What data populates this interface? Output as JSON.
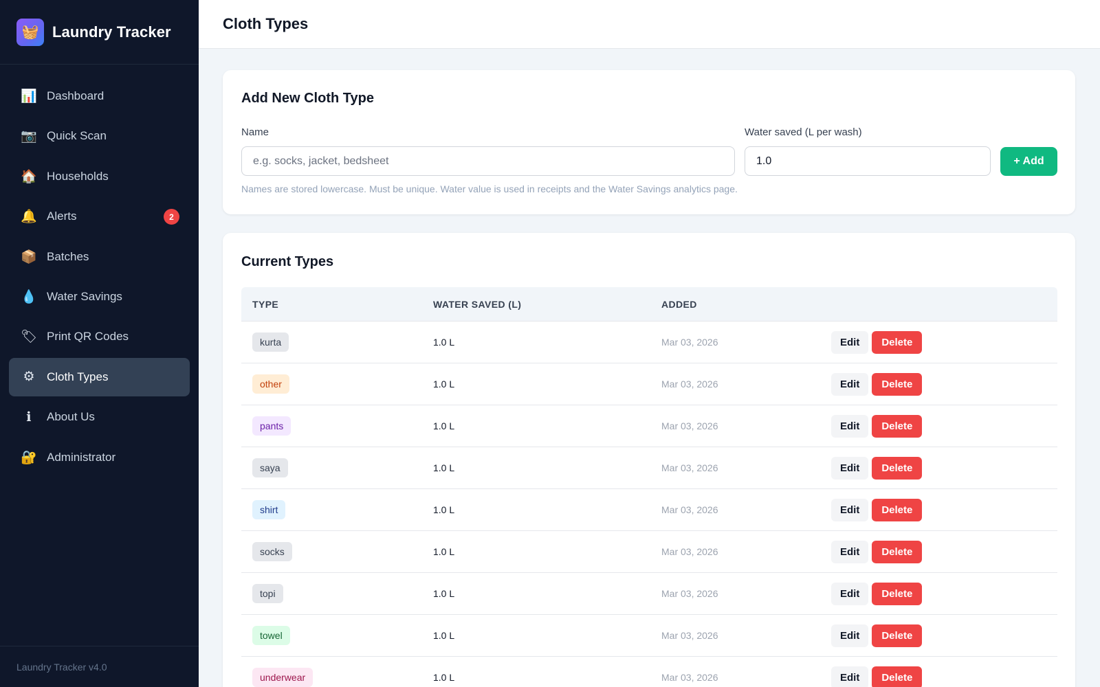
{
  "app": {
    "title": "Laundry Tracker",
    "logo_icon": "basket-icon",
    "version": "Laundry Tracker v4.0"
  },
  "sidebar": {
    "items": [
      {
        "label": "Dashboard",
        "icon": "📊",
        "icon_name": "bar-chart-icon",
        "active": false
      },
      {
        "label": "Quick Scan",
        "icon": "📷",
        "icon_name": "camera-icon",
        "active": false
      },
      {
        "label": "Households",
        "icon": "🏠",
        "icon_name": "house-icon",
        "active": false
      },
      {
        "label": "Alerts",
        "icon": "🔔",
        "icon_name": "bell-icon",
        "active": false,
        "badge": "2"
      },
      {
        "label": "Batches",
        "icon": "📦",
        "icon_name": "package-icon",
        "active": false
      },
      {
        "label": "Water Savings",
        "icon": "💧",
        "icon_name": "water-drop-icon",
        "active": false
      },
      {
        "label": "Print QR Codes",
        "icon": "🏷",
        "icon_name": "label-tag-icon",
        "active": false
      },
      {
        "label": "Cloth Types",
        "icon": "⚙",
        "icon_name": "gear-icon",
        "active": true
      },
      {
        "label": "About Us",
        "icon": "ℹ",
        "icon_name": "info-icon",
        "active": false
      },
      {
        "label": "Administrator",
        "icon": "🔐",
        "icon_name": "lock-icon",
        "active": false
      }
    ]
  },
  "header": {
    "title": "Cloth Types"
  },
  "add_form": {
    "title": "Add New Cloth Type",
    "name_label": "Name",
    "name_placeholder": "e.g. socks, jacket, bedsheet",
    "name_value": "",
    "water_label": "Water saved (L per wash)",
    "water_value": "1.0",
    "add_button": "+ Add",
    "hint": "Names are stored lowercase. Must be unique. Water value is used in receipts and the Water Savings analytics page."
  },
  "list": {
    "title": "Current Types",
    "columns": [
      "TYPE",
      "WATER SAVED (L)",
      "ADDED",
      ""
    ],
    "edit_label": "Edit",
    "delete_label": "Delete",
    "rows": [
      {
        "type": "kurta",
        "water": "1.0 L",
        "added": "Mar 03, 2026",
        "pill_bg": "#e5e7eb",
        "pill_fg": "#374151"
      },
      {
        "type": "other",
        "water": "1.0 L",
        "added": "Mar 03, 2026",
        "pill_bg": "#ffedd5",
        "pill_fg": "#c2410c"
      },
      {
        "type": "pants",
        "water": "1.0 L",
        "added": "Mar 03, 2026",
        "pill_bg": "#f3e8ff",
        "pill_fg": "#6b21a8"
      },
      {
        "type": "saya",
        "water": "1.0 L",
        "added": "Mar 03, 2026",
        "pill_bg": "#e5e7eb",
        "pill_fg": "#374151"
      },
      {
        "type": "shirt",
        "water": "1.0 L",
        "added": "Mar 03, 2026",
        "pill_bg": "#e0f2fe",
        "pill_fg": "#1e3a8a"
      },
      {
        "type": "socks",
        "water": "1.0 L",
        "added": "Mar 03, 2026",
        "pill_bg": "#e5e7eb",
        "pill_fg": "#374151"
      },
      {
        "type": "topi",
        "water": "1.0 L",
        "added": "Mar 03, 2026",
        "pill_bg": "#e5e7eb",
        "pill_fg": "#374151"
      },
      {
        "type": "towel",
        "water": "1.0 L",
        "added": "Mar 03, 2026",
        "pill_bg": "#dcfce7",
        "pill_fg": "#166534"
      },
      {
        "type": "underwear",
        "water": "1.0 L",
        "added": "Mar 03, 2026",
        "pill_bg": "#fce7f3",
        "pill_fg": "#9d174d"
      }
    ]
  },
  "colors": {
    "sidebar_bg": "#0f172a",
    "active_item_bg": "#334155",
    "add_button": "#10b981",
    "delete_button": "#ef4444",
    "badge": "#ef4444"
  }
}
